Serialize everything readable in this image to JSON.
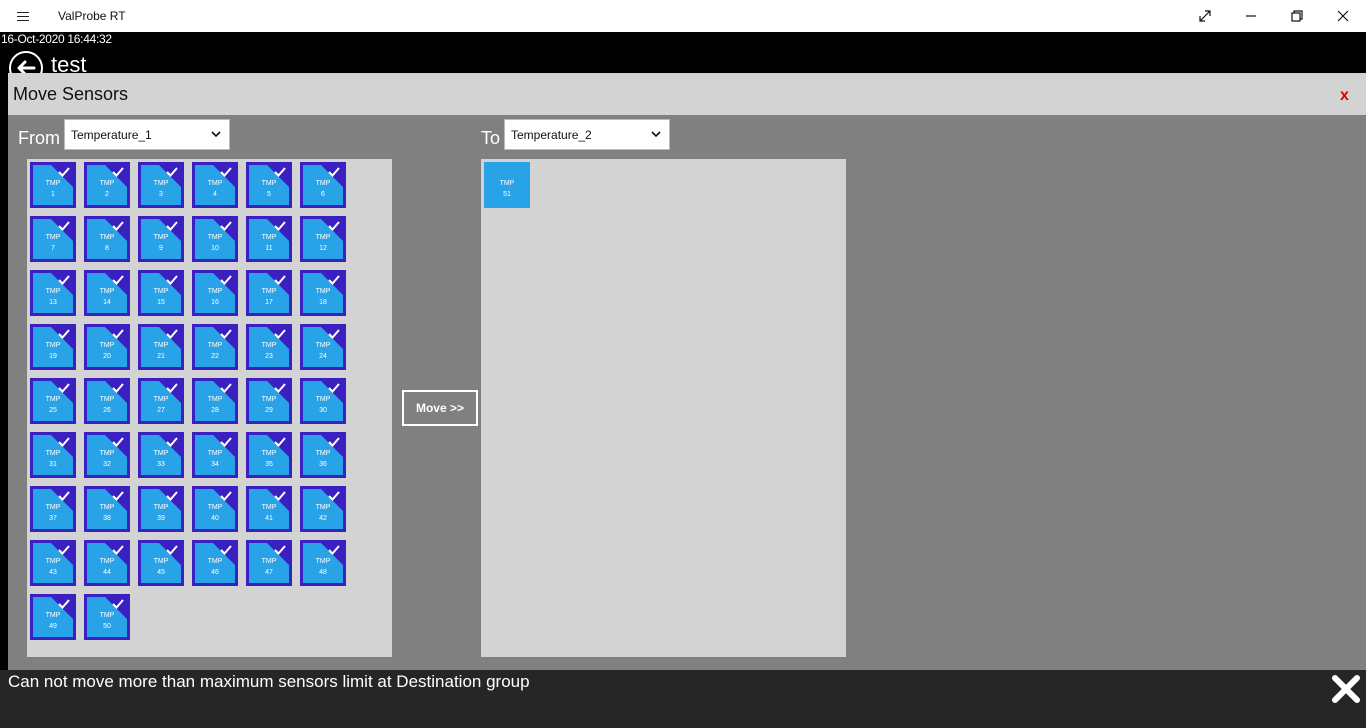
{
  "window": {
    "title": "ValProbe RT",
    "controls": [
      "expand-icon",
      "minimize-icon",
      "restore-icon",
      "close-icon"
    ]
  },
  "header": {
    "timestamp": "16-Oct-2020 16:44:32",
    "page_name": "test",
    "back_icon": "back-arrow-icon"
  },
  "dialog": {
    "title": "Move Sensors",
    "close_label": "x",
    "from_label": "From",
    "from_selected": "Temperature_1",
    "to_label": "To",
    "to_selected": "Temperature_2",
    "move_label": "Move >>"
  },
  "source_sensors": {
    "prefix": "TMP",
    "selected": true,
    "ids": [
      "1",
      "2",
      "3",
      "4",
      "5",
      "6",
      "7",
      "8",
      "9",
      "10",
      "11",
      "12",
      "13",
      "14",
      "15",
      "16",
      "17",
      "18",
      "19",
      "20",
      "21",
      "22",
      "23",
      "24",
      "25",
      "26",
      "27",
      "28",
      "29",
      "30",
      "31",
      "32",
      "33",
      "34",
      "35",
      "36",
      "37",
      "38",
      "39",
      "40",
      "41",
      "42",
      "43",
      "44",
      "45",
      "46",
      "47",
      "48",
      "49",
      "50"
    ]
  },
  "destination_sensors": {
    "prefix": "TMP",
    "ids": [
      "51"
    ]
  },
  "message": {
    "text": "Can not move more than maximum sensors limit at Destination group",
    "close_icon": "close-x-icon"
  },
  "colors": {
    "tile": "#29a3e8",
    "tile_selected_border": "#3a20c0",
    "dialog_bg": "#808080",
    "panel_bg": "#d3d3d3",
    "close_red": "#e00000"
  }
}
